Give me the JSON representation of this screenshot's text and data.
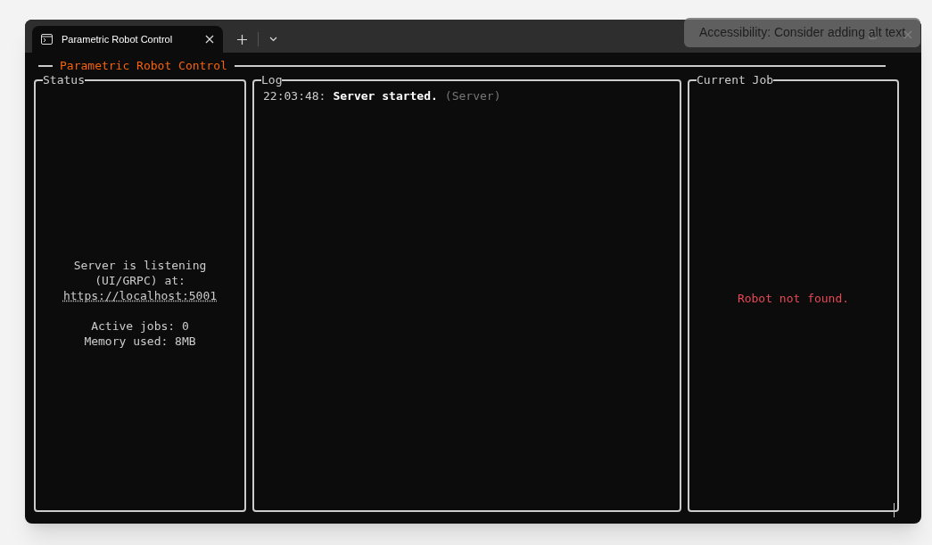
{
  "tab": {
    "title": "Parametric Robot Control",
    "selected": true
  },
  "overlay": {
    "text": "Accessibility: Consider adding alt text"
  },
  "heading": "Parametric Robot Control",
  "panels": [
    {
      "kind": "status",
      "title": "Status",
      "groups": [
        [
          {
            "text": "Server is listening",
            "link": false
          },
          {
            "text": "(UI/GRPC) at:",
            "link": false
          },
          {
            "text": "https://localhost:5001",
            "link": true
          }
        ],
        [
          {
            "text": "Active jobs: 0",
            "link": false
          },
          {
            "text": "Memory used: 8MB",
            "link": false
          }
        ]
      ]
    },
    {
      "kind": "log",
      "title": "Log",
      "entries": [
        {
          "time": "22:03:48:",
          "message": "Server started.",
          "source": "(Server)"
        }
      ]
    },
    {
      "kind": "job",
      "title": "Current Job",
      "message": "Robot not found.",
      "color": "#e74856"
    }
  ]
}
